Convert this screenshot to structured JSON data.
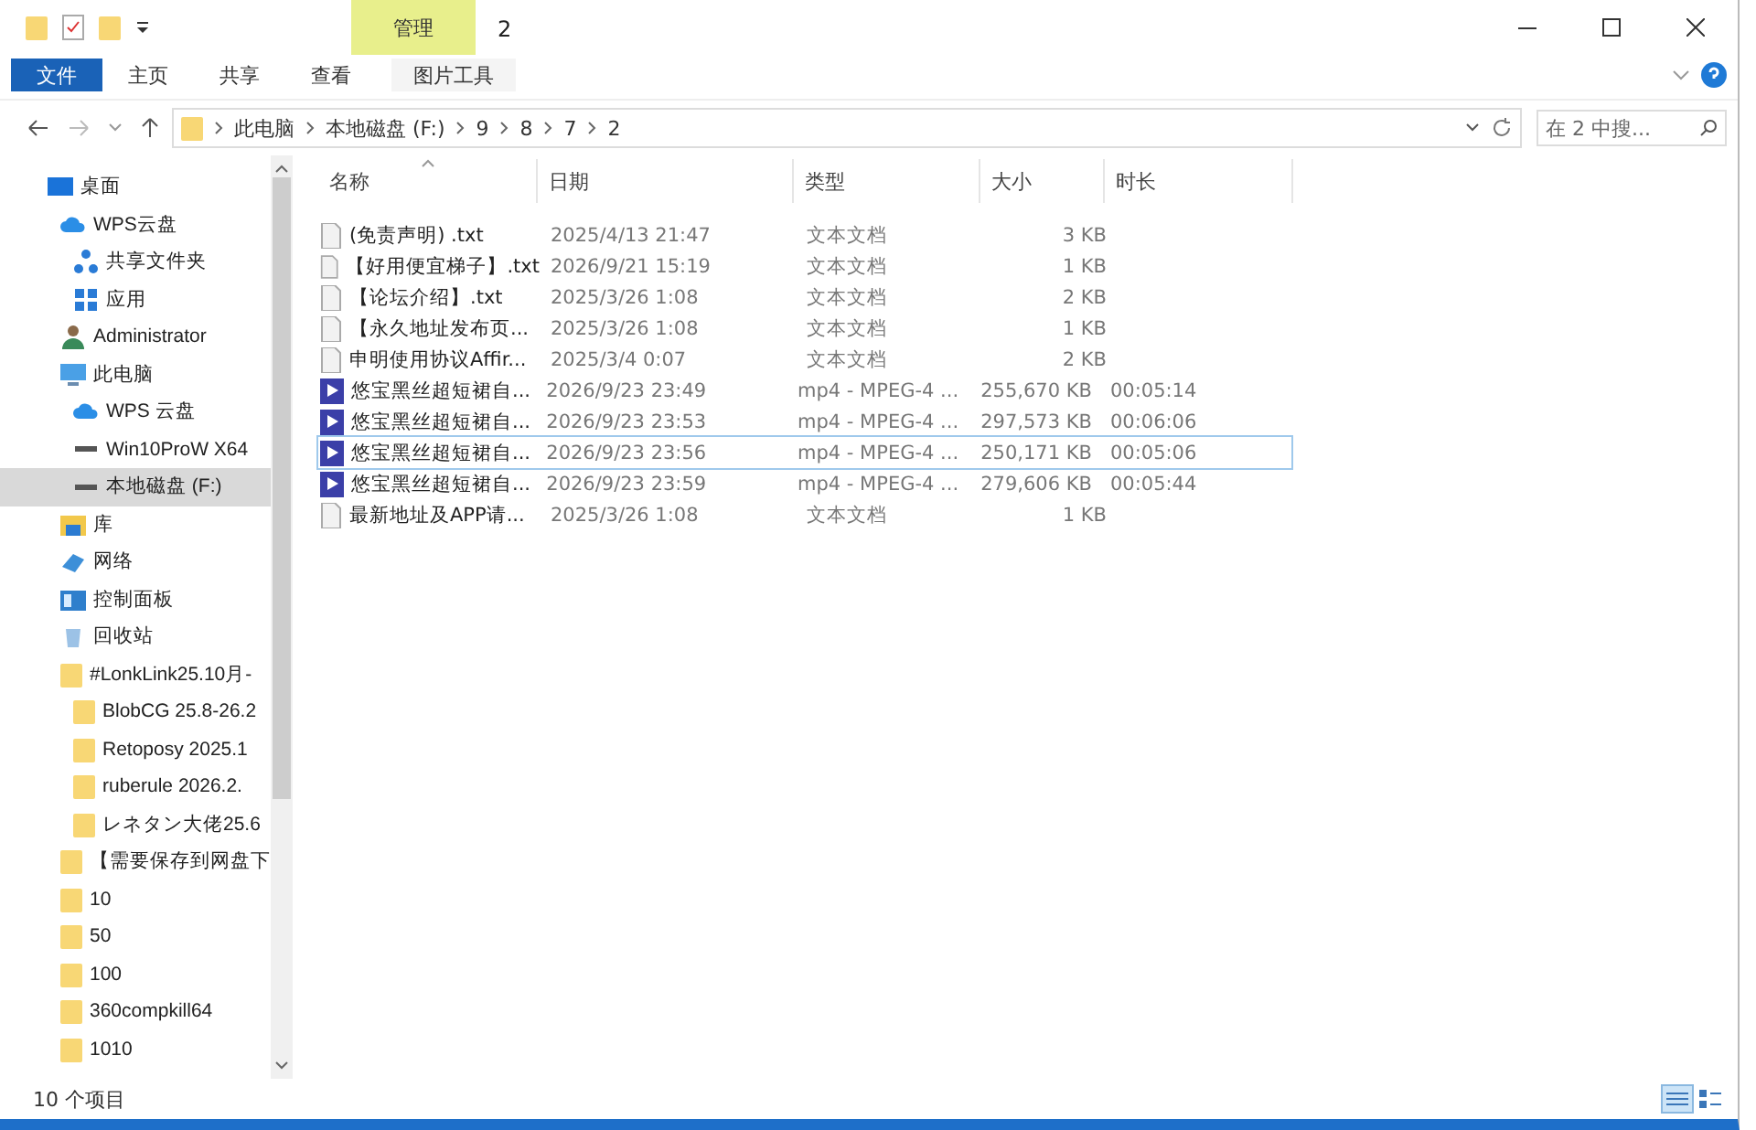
{
  "window": {
    "title": "2"
  },
  "ribbon": {
    "context_group": "管理",
    "tabs": [
      {
        "label": "文件",
        "kind": "file"
      },
      {
        "label": "主页",
        "kind": "tab"
      },
      {
        "label": "共享",
        "kind": "tab"
      },
      {
        "label": "查看",
        "kind": "tab"
      },
      {
        "label": "图片工具",
        "kind": "context"
      }
    ]
  },
  "address": {
    "path": [
      "此电脑",
      "本地磁盘 (F:)",
      "9",
      "8",
      "7",
      "2"
    ],
    "search_placeholder": "在 2 中搜..."
  },
  "nav": [
    {
      "label": "桌面",
      "kind": "desktop",
      "selected": false,
      "children": [
        {
          "label": "WPS云盘",
          "kind": "cloud",
          "selected": false,
          "children": [
            {
              "label": "共享文件夹",
              "kind": "share",
              "selected": false
            },
            {
              "label": "应用",
              "kind": "apps",
              "selected": false
            }
          ]
        },
        {
          "label": "Administrator",
          "kind": "user",
          "selected": false
        },
        {
          "label": "此电脑",
          "kind": "pc",
          "selected": false,
          "children": [
            {
              "label": "WPS 云盘",
              "kind": "cloud",
              "selected": false
            },
            {
              "label": "Win10ProW X64",
              "kind": "drive",
              "selected": false
            },
            {
              "label": "本地磁盘 (F:)",
              "kind": "drive",
              "selected": true
            }
          ]
        },
        {
          "label": "库",
          "kind": "library",
          "selected": false
        },
        {
          "label": "网络",
          "kind": "network",
          "selected": false
        },
        {
          "label": "控制面板",
          "kind": "control",
          "selected": false
        },
        {
          "label": "回收站",
          "kind": "recycle",
          "selected": false
        },
        {
          "label": "#LonkLink25.10月-",
          "kind": "folder",
          "selected": false,
          "children": [
            {
              "label": "BlobCG 25.8-26.2",
              "kind": "folder",
              "selected": false
            },
            {
              "label": "Retoposy 2025.1",
              "kind": "folder",
              "selected": false
            },
            {
              "label": "ruberule 2026.2.",
              "kind": "folder",
              "selected": false
            },
            {
              "label": "レネタン大佬25.6",
              "kind": "folder",
              "selected": false
            }
          ]
        },
        {
          "label": "【需要保存到网盘下",
          "kind": "folder",
          "selected": false
        },
        {
          "label": "10",
          "kind": "folder",
          "selected": false
        },
        {
          "label": "50",
          "kind": "folder",
          "selected": false
        },
        {
          "label": "100",
          "kind": "folder",
          "selected": false
        },
        {
          "label": "360compkill64",
          "kind": "folder",
          "selected": false
        },
        {
          "label": "1010",
          "kind": "folder",
          "selected": false
        }
      ]
    }
  ],
  "table": {
    "columns": [
      "名称",
      "日期",
      "类型",
      "大小",
      "时长"
    ],
    "rows": [
      {
        "kind": "txt",
        "name": "(免责声明) .txt",
        "date": "2025/4/13 21:47",
        "type": "文本文档",
        "size": "3 KB",
        "focused": false
      },
      {
        "kind": "txt",
        "name": "【好用便宜梯子】.txt",
        "date": "2026/9/21 15:19",
        "type": "文本文档",
        "size": "1 KB",
        "focused": false
      },
      {
        "kind": "txt",
        "name": "【论坛介绍】.txt",
        "date": "2025/3/26 1:08",
        "type": "文本文档",
        "size": "2 KB",
        "focused": false
      },
      {
        "kind": "txt",
        "name": "【永久地址发布页...",
        "date": "2025/3/26 1:08",
        "type": "文本文档",
        "size": "1 KB",
        "focused": false
      },
      {
        "kind": "txt",
        "name": "申明使用协议Affir...",
        "date": "2025/3/4 0:07",
        "type": "文本文档",
        "size": "2 KB",
        "focused": false
      },
      {
        "kind": "video",
        "name": "悠宝黑丝超短裙自...",
        "date": "2026/9/23 23:49",
        "type": "mp4 - MPEG-4 ...",
        "size": "255,670 KB",
        "duration": "00:05:14",
        "focused": false
      },
      {
        "kind": "video",
        "name": "悠宝黑丝超短裙自...",
        "date": "2026/9/23 23:53",
        "type": "mp4 - MPEG-4 ...",
        "size": "297,573 KB",
        "duration": "00:06:06",
        "focused": false
      },
      {
        "kind": "video",
        "name": "悠宝黑丝超短裙自...",
        "date": "2026/9/23 23:56",
        "type": "mp4 - MPEG-4 ...",
        "size": "250,171 KB",
        "duration": "00:05:06",
        "focused": true
      },
      {
        "kind": "video",
        "name": "悠宝黑丝超短裙自...",
        "date": "2026/9/23 23:59",
        "type": "mp4 - MPEG-4 ...",
        "size": "279,606 KB",
        "duration": "00:05:44",
        "focused": false
      },
      {
        "kind": "txt",
        "name": "最新地址及APP请...",
        "date": "2025/3/26 1:08",
        "type": "文本文档",
        "size": "1 KB",
        "focused": false
      }
    ]
  },
  "status_bar": {
    "count": "10 个项目",
    "views": [
      {
        "kind": "details",
        "selected": true
      },
      {
        "kind": "tiles",
        "selected": false
      }
    ]
  }
}
